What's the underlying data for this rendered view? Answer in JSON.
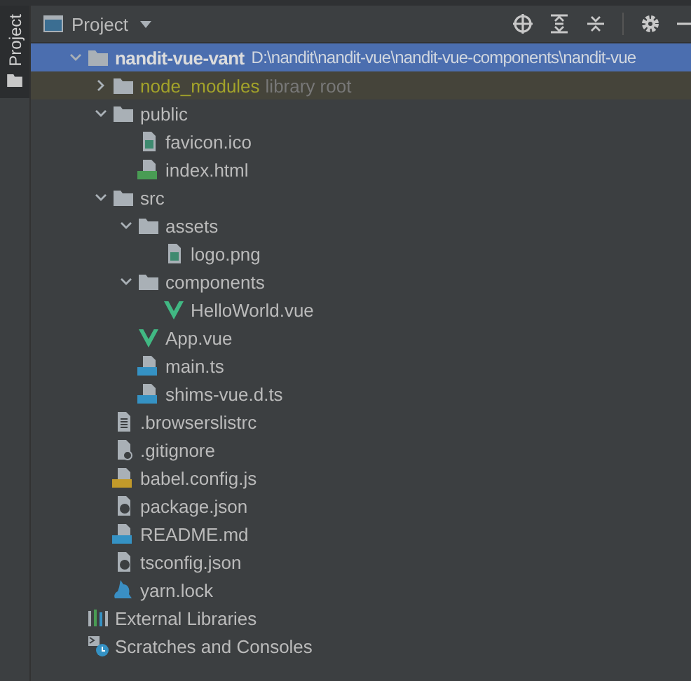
{
  "tool_stripe": {
    "tab_label": "Project"
  },
  "panel": {
    "title": "Project"
  },
  "tree": [
    {
      "label": "nandit-vue-vant",
      "path": "D:\\nandit\\nandit-vue\\nandit-vue-components\\nandit-vue",
      "kind": "folder",
      "bold": true,
      "selected": true,
      "expanded": true,
      "children": [
        {
          "label": "node_modules",
          "note": "library root",
          "kind": "folder",
          "highlighted": true,
          "selected": false,
          "expanded": false
        },
        {
          "label": "public",
          "kind": "folder",
          "selected": false,
          "expanded": true,
          "children": [
            {
              "label": "favicon.ico",
              "kind": "image",
              "selected": false
            },
            {
              "label": "index.html",
              "kind": "html",
              "selected": false
            }
          ]
        },
        {
          "label": "src",
          "kind": "folder",
          "selected": false,
          "expanded": true,
          "children": [
            {
              "label": "assets",
              "kind": "folder",
              "selected": false,
              "expanded": true,
              "children": [
                {
                  "label": "logo.png",
                  "kind": "image",
                  "selected": false
                }
              ]
            },
            {
              "label": "components",
              "kind": "folder",
              "selected": false,
              "expanded": true,
              "children": [
                {
                  "label": "HelloWorld.vue",
                  "kind": "vue",
                  "selected": false
                }
              ]
            },
            {
              "label": "App.vue",
              "kind": "vue",
              "selected": false
            },
            {
              "label": "main.ts",
              "kind": "ts",
              "selected": false
            },
            {
              "label": "shims-vue.d.ts",
              "kind": "ts",
              "selected": false
            }
          ]
        },
        {
          "label": ".browserslistrc",
          "kind": "text",
          "selected": false
        },
        {
          "label": ".gitignore",
          "kind": "ignore",
          "selected": false
        },
        {
          "label": "babel.config.js",
          "kind": "js",
          "selected": false
        },
        {
          "label": "package.json",
          "kind": "json",
          "selected": false
        },
        {
          "label": "README.md",
          "kind": "md",
          "selected": false
        },
        {
          "label": "tsconfig.json",
          "kind": "json",
          "selected": false
        },
        {
          "label": "yarn.lock",
          "kind": "yarn",
          "selected": false
        }
      ]
    },
    {
      "label": "External Libraries",
      "kind": "libraries",
      "selected": false
    },
    {
      "label": "Scratches and Consoles",
      "kind": "scratches",
      "selected": false
    }
  ]
}
